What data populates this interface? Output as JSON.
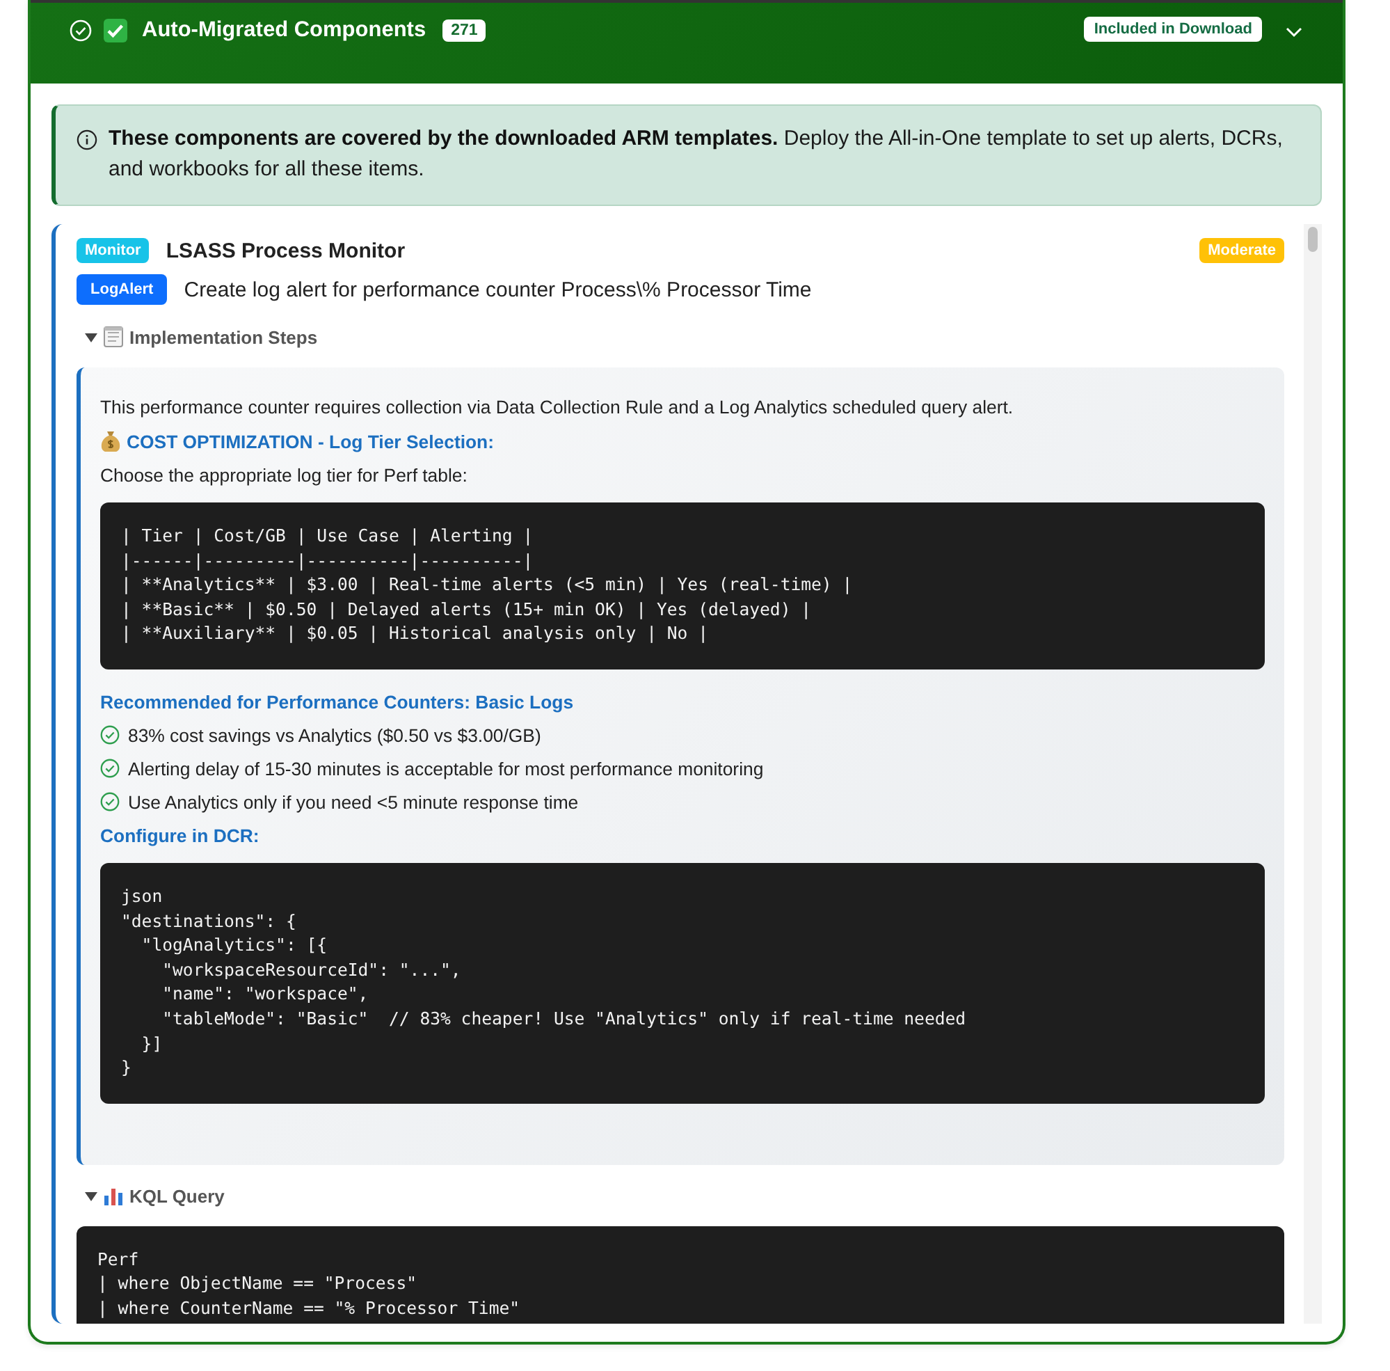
{
  "header": {
    "title": "Auto-Migrated Components",
    "count": "271",
    "badge": "Included in Download",
    "expanded": true
  },
  "notice": {
    "text": "**These components are covered by the downloaded ARM templates.** Deploy the All-in-One template to set up alerts, DCRs, and workbooks for all these items."
  },
  "items": [
    {
      "category": "Monitor",
      "name": "LSASS Process Monitor",
      "severity": "Moderate",
      "type": "LogAlert",
      "description": "Create log alert for performance counter Process\\% Processor Time",
      "sections": [
        {
          "kind": "steps",
          "title": "Implementation Steps",
          "expanded": true,
          "blocks": [
            {
              "kind": "paragraph",
              "text": "This performance counter requires collection via Data Collection Rule and a Log Analytics scheduled query alert."
            },
            {
              "kind": "cost-heading",
              "text": "COST OPTIMIZATION - Log Tier Selection:"
            },
            {
              "kind": "paragraph",
              "text": "Choose the appropriate log tier for Perf table:"
            },
            {
              "kind": "code",
              "text": "| Tier | Cost/GB | Use Case | Alerting |\n|------|---------|----------|----------|\n| **Analytics** | $3.00 | Real-time alerts (<5 min) | Yes (real-time) |\n| **Basic** | $0.50 | Delayed alerts (15+ min OK) | Yes (delayed) |\n| **Auxiliary** | $0.05 | Historical analysis only | No |"
            },
            {
              "kind": "heading",
              "text": "Recommended for Performance Counters: Basic Logs"
            },
            {
              "kind": "check",
              "text": "83% cost savings vs Analytics ($0.50 vs $3.00/GB)"
            },
            {
              "kind": "check",
              "text": "Alerting delay of 15-30 minutes is acceptable for most performance monitoring"
            },
            {
              "kind": "check",
              "text": "Use Analytics only if you need <5 minute response time"
            },
            {
              "kind": "heading",
              "text": "Configure in DCR:"
            },
            {
              "kind": "code",
              "text": "json\n\"destinations\": {\n  \"logAnalytics\": [{\n    \"workspaceResourceId\": \"...\",\n    \"name\": \"workspace\",\n    \"tableMode\": \"Basic\"  // 83% cheaper! Use \"Analytics\" only if real-time needed\n  }]\n}"
            }
          ]
        },
        {
          "kind": "query",
          "title": "KQL Query",
          "expanded": true,
          "blocks": [
            {
              "kind": "code",
              "text": "Perf\n| where ObjectName == \"Process\"\n| where CounterName == \"% Processor Time\""
            }
          ]
        }
      ]
    }
  ]
}
